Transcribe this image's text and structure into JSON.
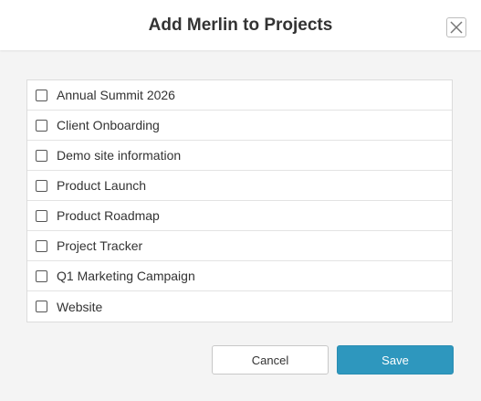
{
  "dialog": {
    "title": "Add Merlin to Projects",
    "close_icon": "close-icon"
  },
  "projects": [
    {
      "label": "Annual Summit 2026",
      "checked": false
    },
    {
      "label": "Client Onboarding",
      "checked": false
    },
    {
      "label": "Demo site information",
      "checked": false
    },
    {
      "label": "Product Launch",
      "checked": false
    },
    {
      "label": "Product Roadmap",
      "checked": false
    },
    {
      "label": "Project Tracker",
      "checked": false
    },
    {
      "label": "Q1 Marketing Campaign",
      "checked": false
    },
    {
      "label": "Website",
      "checked": false
    }
  ],
  "footer": {
    "cancel_label": "Cancel",
    "save_label": "Save"
  },
  "colors": {
    "primary": "#2e97be",
    "background": "#f4f4f4",
    "header": "#ffffff"
  }
}
